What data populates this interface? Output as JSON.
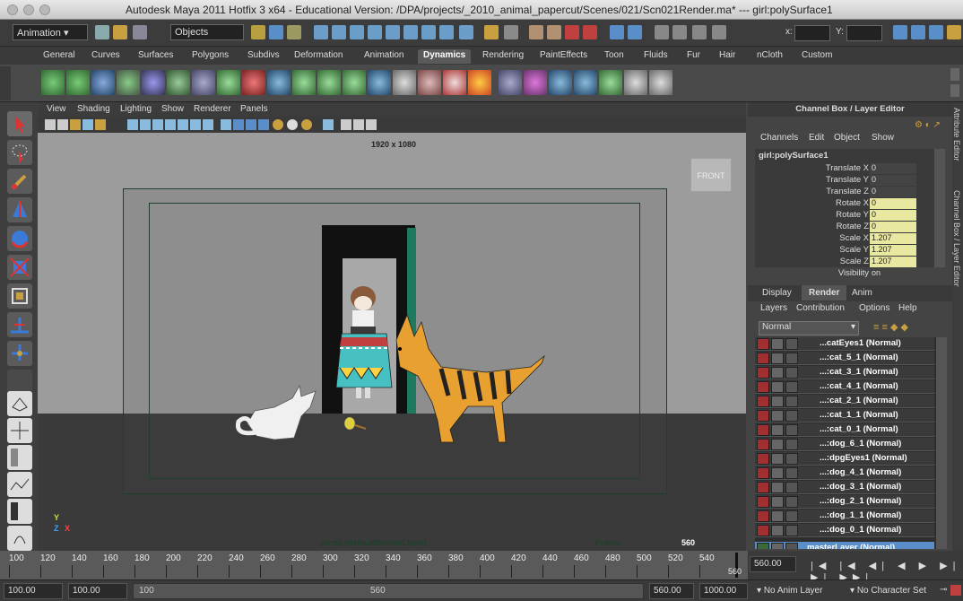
{
  "window": {
    "title": "Autodesk Maya 2011 Hotfix 3 x64 - Educational Version: /DPA/projects/_2010_animal_papercut/Scenes/021/Scn021Render.ma*  ---  girl:polySurface1"
  },
  "status_line": {
    "mode": "Animation",
    "selection_mode": "Objects",
    "x_label": "x:",
    "y_label": "Y:"
  },
  "shelf_tabs": [
    "General",
    "Curves",
    "Surfaces",
    "Polygons",
    "Subdivs",
    "Deformation",
    "Animation",
    "Dynamics",
    "Rendering",
    "PaintEffects",
    "Toon",
    "Fluids",
    "Fur",
    "Hair",
    "nCloth",
    "Custom"
  ],
  "active_shelf": "Dynamics",
  "viewport": {
    "menus": [
      "View",
      "Shading",
      "Lighting",
      "Show",
      "Renderer",
      "Panels"
    ],
    "resolution": "1920 x 1080",
    "view_cube": "FRONT",
    "camera_label": "persp (defaultRenderLayer)",
    "frame_label": "Frame:",
    "frame_value": "560",
    "axis_y": "Y",
    "axis_z": "Z",
    "axis_x": "X"
  },
  "channel_box": {
    "header": "Channel Box / Layer Editor",
    "menus": [
      "Channels",
      "Edit",
      "Object",
      "Show"
    ],
    "object": "girl:polySurface1",
    "attrs": [
      {
        "label": "Translate X",
        "value": "0",
        "hl": false
      },
      {
        "label": "Translate Y",
        "value": "0",
        "hl": false
      },
      {
        "label": "Translate Z",
        "value": "0",
        "hl": false
      },
      {
        "label": "Rotate X",
        "value": "0",
        "hl": true
      },
      {
        "label": "Rotate Y",
        "value": "0",
        "hl": true
      },
      {
        "label": "Rotate Z",
        "value": "0",
        "hl": true
      },
      {
        "label": "Scale X",
        "value": "1.207",
        "hl": true
      },
      {
        "label": "Scale Y",
        "value": "1.207",
        "hl": true
      },
      {
        "label": "Scale Z",
        "value": "1.207",
        "hl": true
      },
      {
        "label": "Visibility",
        "value": "on",
        "hl": false
      }
    ]
  },
  "layer_editor": {
    "tabs": [
      "Display",
      "Render",
      "Anim"
    ],
    "active_tab": "Render",
    "menus": [
      "Layers",
      "Contribution",
      "Options",
      "Help"
    ],
    "blend_mode": "Normal",
    "layers": [
      "...catEyes1 (Normal)",
      "...:cat_5_1 (Normal)",
      "...:cat_3_1 (Normal)",
      "...:cat_4_1 (Normal)",
      "...:cat_2_1 (Normal)",
      "...:cat_1_1 (Normal)",
      "...:cat_0_1 (Normal)",
      "...:dog_6_1 (Normal)",
      "...:dpgEyes1 (Normal)",
      "...:dog_4_1 (Normal)",
      "...:dog_3_1 (Normal)",
      "...:dog_2_1 (Normal)",
      "...:dog_1_1 (Normal)",
      "...:dog_0_1 (Normal)"
    ],
    "master_layer": "masterLayer (Normal)"
  },
  "side_tabs": [
    "Attribute Editor",
    "Channel Box / Layer Editor"
  ],
  "timeline": {
    "ticks": [
      "100",
      "120",
      "140",
      "160",
      "180",
      "200",
      "220",
      "240",
      "260",
      "280",
      "300",
      "320",
      "340",
      "360",
      "380",
      "400",
      "420",
      "440",
      "460",
      "480",
      "500",
      "520",
      "540",
      "560"
    ],
    "current_frame": "560",
    "current_time_field": "560.00"
  },
  "range": {
    "start_anim": "100.00",
    "start_play": "100.00",
    "slider_start": "100",
    "slider_end": "560",
    "end_play": "560.00",
    "end_anim": "1000.00",
    "anim_layer": "No Anim Layer",
    "char_set": "No Character Set"
  },
  "colors": {
    "accent_blue": "#5a8ec8",
    "layer_red": "#a03030",
    "attr_yellow": "#e8e8a0"
  }
}
